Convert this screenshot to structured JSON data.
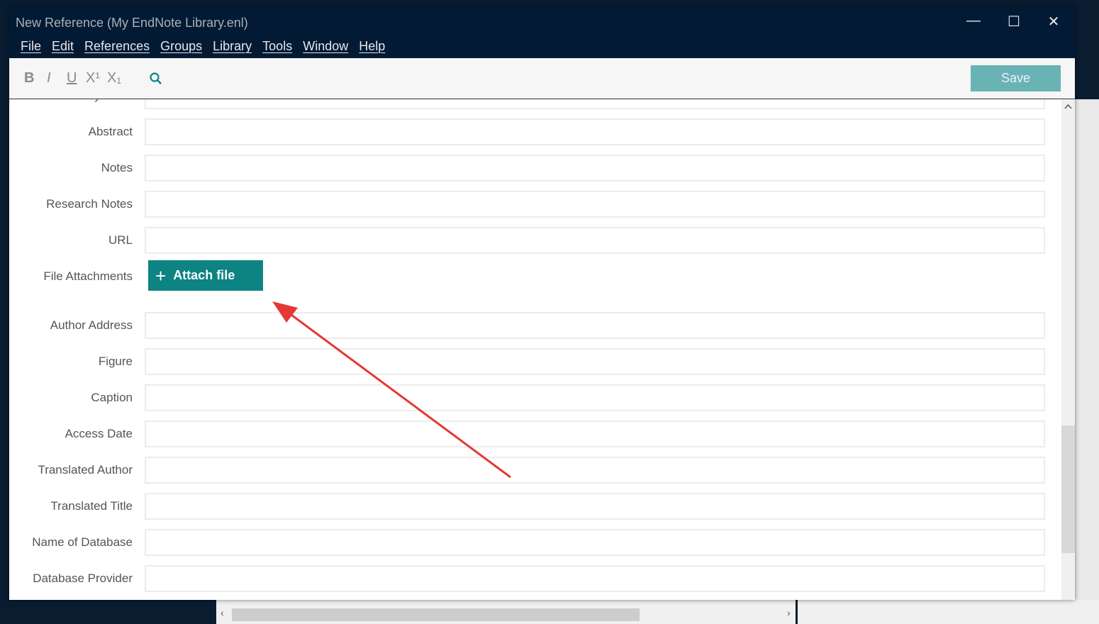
{
  "window": {
    "title": "New Reference (My EndNote Library.enl)"
  },
  "menu": [
    "File",
    "Edit",
    "References",
    "Groups",
    "Library",
    "Tools",
    "Window",
    "Help"
  ],
  "toolbar": {
    "bold": "B",
    "italic": "I",
    "underline": "U",
    "superscript": "X¹",
    "subscript": "X₁",
    "save_label": "Save"
  },
  "fields": [
    {
      "label": "Keywords",
      "value": ""
    },
    {
      "label": "Abstract",
      "value": ""
    },
    {
      "label": "Notes",
      "value": ""
    },
    {
      "label": "Research Notes",
      "value": ""
    },
    {
      "label": "URL",
      "value": ""
    },
    {
      "label": "File Attachments",
      "button": "Attach file"
    },
    {
      "label": "Author Address",
      "value": ""
    },
    {
      "label": "Figure",
      "value": ""
    },
    {
      "label": "Caption",
      "value": ""
    },
    {
      "label": "Access Date",
      "value": ""
    },
    {
      "label": "Translated Author",
      "value": ""
    },
    {
      "label": "Translated Title",
      "value": ""
    },
    {
      "label": "Name of Database",
      "value": ""
    },
    {
      "label": "Database Provider",
      "value": ""
    }
  ],
  "colors": {
    "titlebar": "#021a33",
    "accent": "#0d8383",
    "save": "#69b3b5",
    "annotation": "#e53935"
  }
}
